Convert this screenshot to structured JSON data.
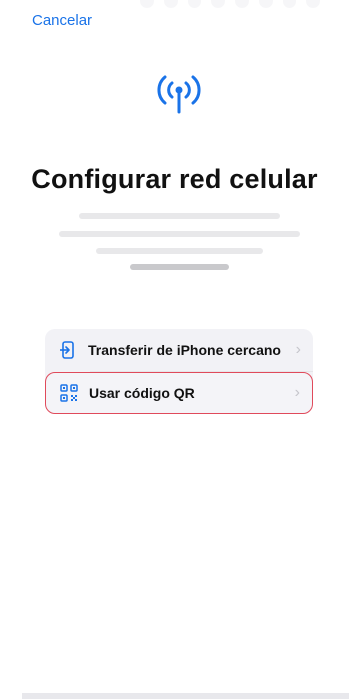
{
  "header": {
    "cancel_label": "Cancelar"
  },
  "hero": {
    "icon": "antenna-signal-icon",
    "title": "Configurar red celular"
  },
  "options": [
    {
      "label": "Transferir de iPhone cercano",
      "icon": "phone-transfer-icon"
    },
    {
      "label": "Usar código QR",
      "icon": "qr-code-icon"
    }
  ],
  "colors": {
    "accent": "#1a73e8",
    "highlight": "#e04a5b",
    "row_background": "#f2f2f6"
  }
}
